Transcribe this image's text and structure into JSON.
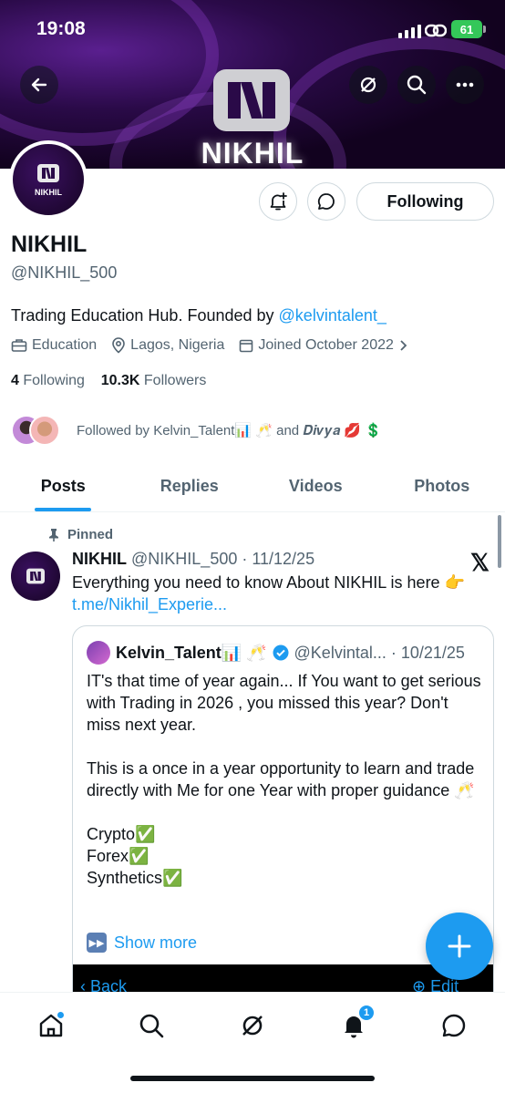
{
  "status_bar": {
    "time": "19:08",
    "battery": "61"
  },
  "banner": {
    "name": "NIKHIL"
  },
  "avatar": {
    "name": "NIKHIL"
  },
  "profile": {
    "follow_button": "Following",
    "display_name": "NIKHIL",
    "handle": "@NIKHIL_500",
    "bio_text": "Trading Education Hub. Founded by ",
    "bio_mention": "@kelvintalent_",
    "category": "Education",
    "location": "Lagos, Nigeria",
    "joined": "Joined October 2022",
    "following_count": "4",
    "following_label": "Following",
    "followers_count": "10.3K",
    "followers_label": "Followers",
    "followed_by": "Followed by Kelvin_Talent📊 🥂 and 𝑫𝒊𝒗𝒚𝒂 💋 💲"
  },
  "tabs": [
    "Posts",
    "Replies",
    "Videos",
    "Photos"
  ],
  "post": {
    "pinned_label": "Pinned",
    "author": "NIKHIL",
    "meta": "@NIKHIL_500 · 11/12/25",
    "text": "Everything you need to know About NIKHIL is here 👉",
    "link": "t.me/Nikhil_Experie...",
    "platform_logo": "𝕏"
  },
  "quote": {
    "author": "Kelvin_Talent📊 🥂",
    "handle": "@Kelvintal... · 10/21/25",
    "body": "IT's that time of year again... If You want to get serious with Trading in 2026 , you missed this year? Don't miss next year.\n\nThis is a once in a year opportunity to learn and trade directly with Me for one Year with  proper guidance 🥂\n\nCrypto✅\nForex✅\nSynthetics✅",
    "show_more": "Show more",
    "media_back": "Back",
    "media_edit": "Edit"
  },
  "nav": {
    "notifications_badge": "1"
  },
  "colors": {
    "accent": "#1d9bf0",
    "text": "#0f1419",
    "muted": "#536471",
    "banner": "#2a0a48"
  },
  "icons": [
    "back-arrow-icon",
    "grok-icon",
    "search-icon",
    "more-icon",
    "add-notification-icon",
    "message-icon",
    "briefcase-icon",
    "location-icon",
    "calendar-icon",
    "chevron-right-icon",
    "pin-icon",
    "verified-icon",
    "compose-plus-icon",
    "home-icon",
    "bell-icon"
  ]
}
